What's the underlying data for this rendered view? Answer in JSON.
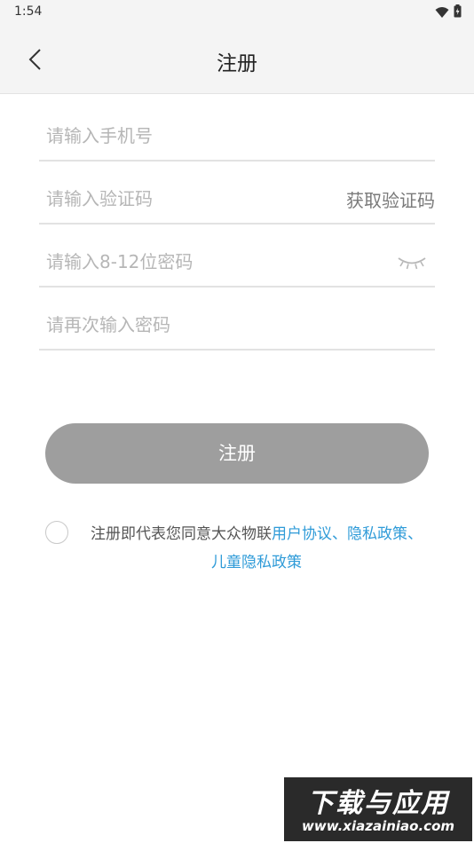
{
  "status_bar": {
    "time": "1:54"
  },
  "header": {
    "title": "注册"
  },
  "form": {
    "phone": {
      "placeholder": "请输入手机号",
      "value": ""
    },
    "code": {
      "placeholder": "请输入验证码",
      "value": "",
      "button_label": "获取验证码"
    },
    "password": {
      "placeholder": "请输入8-12位密码",
      "value": ""
    },
    "confirm": {
      "placeholder": "请再次输入密码",
      "value": ""
    }
  },
  "submit_label": "注册",
  "agreement": {
    "prefix": "注册即代表您同意大众物联",
    "link_user": "用户协议",
    "sep1": "、",
    "link_privacy": "隐私政策",
    "sep2": "、",
    "link_child": "儿童隐私政策"
  },
  "watermark": {
    "line1": "下载与应用",
    "line2": "www.xiazainiao.com"
  },
  "colors": {
    "link": "#2f9bd8",
    "button": "#9e9e9e",
    "header_bg": "#f4f4f4"
  },
  "icons": {
    "back": "chevron-left-icon",
    "eye": "eye-closed-icon",
    "wifi": "wifi-icon",
    "battery": "battery-icon"
  }
}
